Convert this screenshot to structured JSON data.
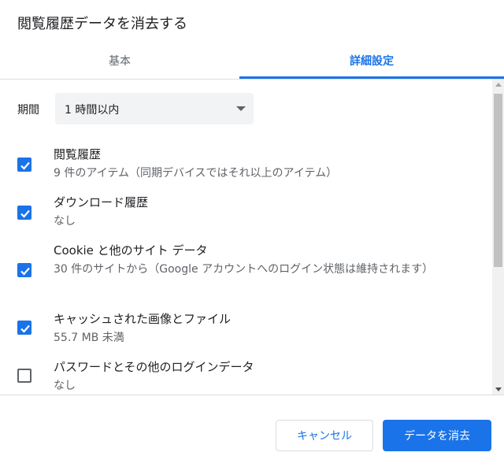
{
  "dialog": {
    "title": "閲覧履歴データを消去する"
  },
  "tabs": [
    {
      "label": "基本",
      "selected": false
    },
    {
      "label": "詳細設定",
      "selected": true
    }
  ],
  "period": {
    "label": "期間",
    "value": "1 時間以内"
  },
  "options": [
    {
      "title": "閲覧履歴",
      "description": "9 件のアイテム（同期デバイスではそれ以上のアイテム）",
      "checked": true
    },
    {
      "title": "ダウンロード履歴",
      "description": "なし",
      "checked": true
    },
    {
      "title": "Cookie と他のサイト データ",
      "description": "30 件のサイトから（Google アカウントへのログイン状態は維持されます）",
      "checked": true
    },
    {
      "title": "キャッシュされた画像とファイル",
      "description": "55.7 MB 未満",
      "checked": true
    },
    {
      "title": "パスワードとその他のログインデータ",
      "description": "なし",
      "checked": false
    }
  ],
  "buttons": {
    "cancel": "キャンセル",
    "clear": "データを消去"
  },
  "colors": {
    "accent": "#1a73e8",
    "text": "#202124",
    "secondary_text": "#5f6368",
    "divider": "#dadce0"
  }
}
